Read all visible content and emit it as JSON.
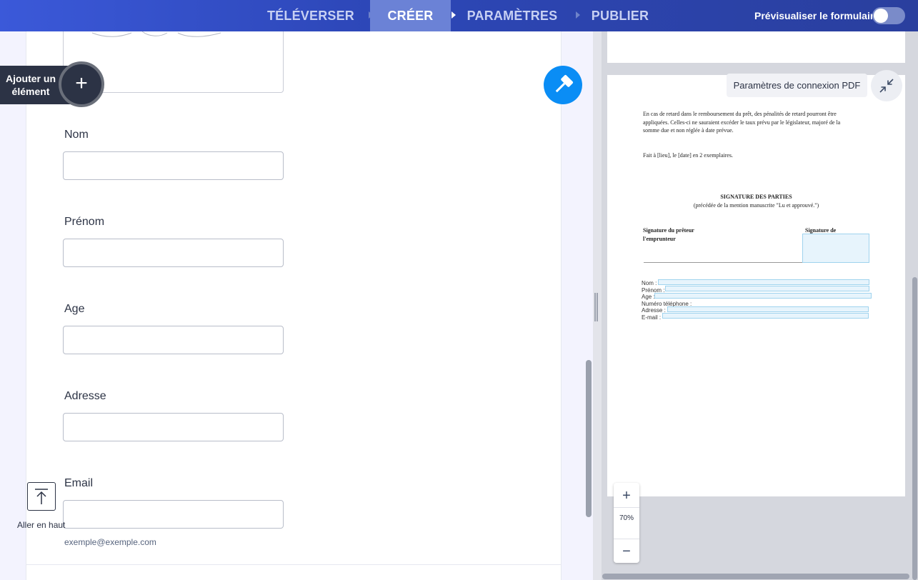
{
  "nav": {
    "steps": [
      {
        "label": "TÉLÉVERSER"
      },
      {
        "label": "CRÉER"
      },
      {
        "label": "PARAMÈTRES"
      },
      {
        "label": "PUBLIER"
      }
    ],
    "active_step": "CRÉER",
    "preview_label": "Prévisualiser le formulaire",
    "preview_enabled": false
  },
  "form": {
    "add_element_label": "Ajouter un élément",
    "fields": [
      {
        "label": "Nom",
        "value": ""
      },
      {
        "label": "Prénom",
        "value": ""
      },
      {
        "label": "Age",
        "value": ""
      },
      {
        "label": "Adresse",
        "value": ""
      },
      {
        "label": "Email",
        "value": "",
        "sublabel": "exemple@exemple.com"
      }
    ],
    "go_top_label": "Aller en haut"
  },
  "pdf": {
    "settings_button": "Paramètres de connexion PDF",
    "paragraph": [
      "En cas de retard dans le remboursement du prêt, des pénalités de retard pourront être",
      "appliquées. Celles-ci ne sauraient excéder le taux prévu par le législateur, majoré de la",
      "somme due et non réglée à date prévue."
    ],
    "fait_a": "Fait à  [lieu], le [date] en 2 exemplaires.",
    "signature_title": "SIGNATURE DES PARTIES",
    "signature_subtitle": "(précédée de la mention manuscrite \"Lu et approuvé.\")",
    "signature_preteur": "Signature du prêteur",
    "signature_de": "Signature de",
    "emprunteur": "l'emprunteur",
    "mapped_fields": [
      "Nom :",
      "Prénom :",
      "Age :",
      "Numéro téléphone :",
      "Adresse :",
      "E-mail :"
    ],
    "zoom_level": "70%"
  },
  "colors": {
    "accent": "#0a8df5",
    "nav_start": "#3b59d9",
    "nav_end": "#2a3f9e",
    "dark": "#2c3345"
  }
}
